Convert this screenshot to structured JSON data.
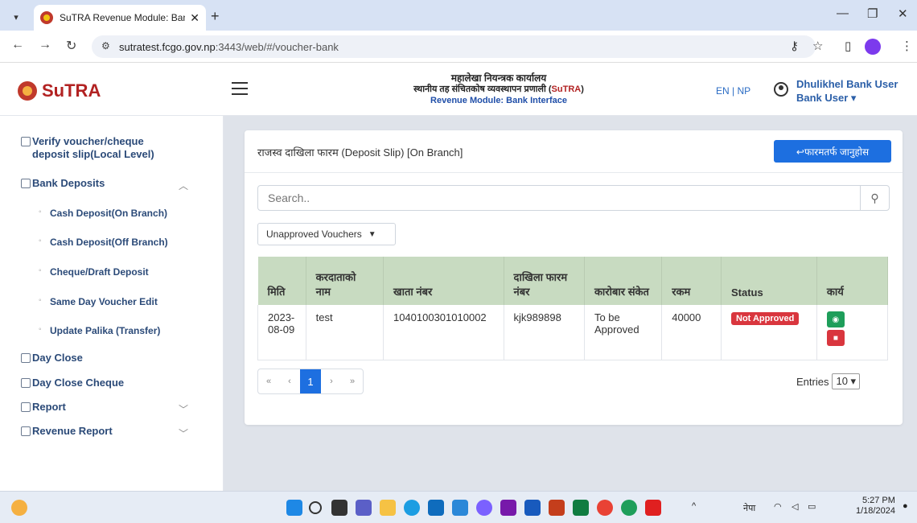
{
  "browser": {
    "tab_title": "SuTRA Revenue Module: Bank I",
    "url_host": "sutratest.fcgo.gov.np",
    "url_path": ":3443/web/#/voucher-bank"
  },
  "header": {
    "logo_text": "SuTRA",
    "title_line1": "महालेखा नियन्त्रक कार्यालय",
    "title_line2_prefix": "स्थानीय तह संचितकोष व्यवस्थापन प्रणाली (",
    "title_line2_accent": "SuTRA",
    "title_line2_suffix": ")",
    "title_line3": "Revenue Module: Bank Interface",
    "language": "EN | NP",
    "user_name": "Dhulikhel Bank User",
    "user_role": "Bank User ▾"
  },
  "sidebar": {
    "items": [
      {
        "label": "Verify voucher/cheque"
      },
      {
        "label": "deposit slip(Local Level)"
      },
      {
        "label": "Bank Deposits"
      },
      {
        "label": "Cash Deposit(On Branch)"
      },
      {
        "label": "Cash Deposit(Off Branch)"
      },
      {
        "label": "Cheque/Draft Deposit"
      },
      {
        "label": "Same Day Voucher Edit"
      },
      {
        "label": "Update Palika (Transfer)"
      },
      {
        "label": "Day Close"
      },
      {
        "label": "Day Close Cheque"
      },
      {
        "label": "Report"
      },
      {
        "label": "Revenue Report"
      }
    ]
  },
  "main": {
    "card_title": "राजस्व दाखिला फारम (Deposit Slip) [On Branch]",
    "back_button": "↩फारमतर्फ जानुहोस",
    "search_placeholder": "Search..",
    "filter_value": "Unapproved Vouchers",
    "table": {
      "headers": [
        "मिति",
        "करदाताको नाम",
        "खाता नंबर",
        "दाखिला फारम नंबर",
        "कारोबार संकेत",
        "रकम",
        "Status",
        "कार्य"
      ],
      "rows": [
        {
          "date": "2023-08-09",
          "taxpayer": "test",
          "account": "1040100301010002",
          "form_no": "kjk989898",
          "txn_code": "To be Approved",
          "amount": "40000",
          "status": "Not Approved"
        }
      ]
    },
    "pagination": {
      "first": "«",
      "prev": "‹",
      "current": "1",
      "next": "›",
      "last": "»"
    },
    "entries_label": "Entries",
    "entries_value": "10"
  },
  "taskbar": {
    "language": "नेपा",
    "time": "5:27 PM",
    "date": "1/18/2024"
  },
  "colors": {
    "primary": "#1d6fe0",
    "table_header": "#c8dbc1",
    "danger": "#d9363e",
    "success": "#1e9e5a",
    "brand": "#b22222"
  }
}
